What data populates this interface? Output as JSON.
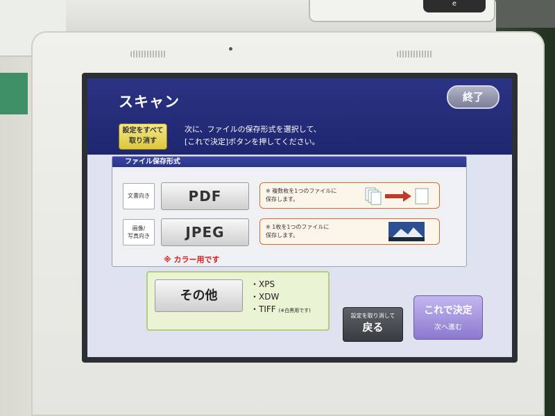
{
  "kiosk": {
    "badge_text": "e"
  },
  "header": {
    "title": "スキャン",
    "exit_label": "終了",
    "reset_label_line1": "設定をすべて",
    "reset_label_line2": "取り消す",
    "instruction_line1": "次に、ファイルの保存形式を選択して、",
    "instruction_line2": "[これで決定]ボタンを押してください。"
  },
  "format_section": {
    "title": "ファイル保存形式",
    "rows": [
      {
        "label_line1": "文書向き",
        "label_line2": "",
        "button": "PDF",
        "desc_line1": "※ 複数枚を1つのファイルに",
        "desc_line2": "保存します。"
      },
      {
        "label_line1": "画像/",
        "label_line2": "写真向き",
        "button": "JPEG",
        "desc_line1": "※ 1枚を1つのファイルに",
        "desc_line2": "保存します。"
      }
    ],
    "color_note": "※ カラー用です"
  },
  "other": {
    "button": "その他",
    "items": [
      "・XPS",
      "・XDW",
      "・TIFF"
    ],
    "tiff_note": "(※白黒用です)"
  },
  "back": {
    "sub": "設定を取り消して",
    "main": "戻る"
  },
  "confirm": {
    "main": "これで決定",
    "sub": "次へ進む"
  },
  "colors": {
    "header_bg": "#232a78",
    "accent_yellow": "#dcc73a",
    "desc_border": "#d8692e",
    "other_bg": "#eaf3d4",
    "confirm_bg": "#8b79cf",
    "note_red": "#d61e1e"
  }
}
